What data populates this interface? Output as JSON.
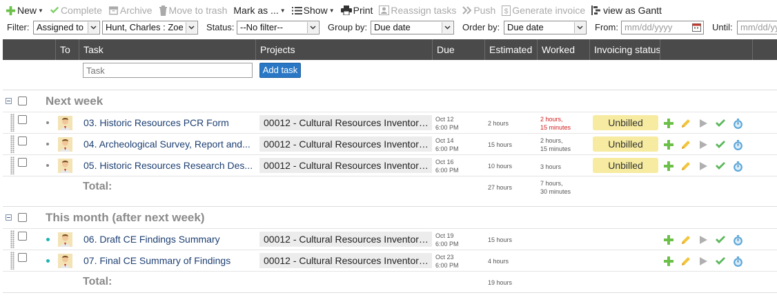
{
  "toolbar": {
    "new_label": "New",
    "complete_label": "Complete",
    "archive_label": "Archive",
    "trash_label": "Move to trash",
    "mark_label": "Mark as ...",
    "show_label": "Show",
    "print_label": "Print",
    "reassign_label": "Reassign tasks",
    "push_label": "Push",
    "invoice_label": "Generate invoice",
    "gantt_label": "view as Gantt"
  },
  "filters": {
    "filter_label": "Filter:",
    "filter_value": "Assigned to",
    "user_value": "Hunt, Charles : Zoe",
    "status_label": "Status:",
    "status_value": "--No filter--",
    "group_label": "Group by:",
    "group_value": "Due date",
    "order_label": "Order by:",
    "order_value": "Due date",
    "from_label": "From:",
    "from_placeholder": "mm/dd/yyyy",
    "until_label": "Until:",
    "until_placeholder": "mm/dd/yyyy"
  },
  "columns": {
    "to": "To",
    "task": "Task",
    "projects": "Projects",
    "due": "Due",
    "estimated": "Estimated",
    "worked": "Worked",
    "invoicing": "Invoicing status"
  },
  "add": {
    "task_placeholder": "Task",
    "button_label": "Add task"
  },
  "groups": [
    {
      "title": "Next week",
      "rows": [
        {
          "name": "03. Historic Resources PCR Form",
          "project": "00012 - Cultural Resources Inventory ...",
          "due_date": "Oct 12",
          "due_time": "6:00 PM",
          "estimated": "2 hours",
          "worked_1": "2 hours,",
          "worked_2": "15 minutes",
          "status": "Unbilled"
        },
        {
          "name": "04. Archeological Survey, Report and...",
          "project": "00012 - Cultural Resources Inventory ...",
          "due_date": "Oct 14",
          "due_time": "6:00 PM",
          "estimated": "15 hours",
          "worked_1": "2 hours,",
          "worked_2": "15 minutes",
          "status": "Unbilled"
        },
        {
          "name": "05. Historic Resources Research Des...",
          "project": "00012 - Cultural Resources Inventory ...",
          "due_date": "Oct 16",
          "due_time": "6:00 PM",
          "estimated": "10 hours",
          "worked_1": "3 hours",
          "worked_2": "",
          "status": "Unbilled"
        }
      ],
      "total_label": "Total:",
      "total_estimated": "27 hours",
      "total_worked_1": "7 hours,",
      "total_worked_2": "30 minutes"
    },
    {
      "title": "This month (after next week)",
      "rows": [
        {
          "name": "06. Draft CE Findings Summary",
          "project": "00012 - Cultural Resources Inventory ...",
          "due_date": "Oct 19",
          "due_time": "6:00 PM",
          "estimated": "15 hours"
        },
        {
          "name": "07. Final CE Summary of Findings",
          "project": "00012 - Cultural Resources Inventory ...",
          "due_date": "Oct 23",
          "due_time": "6:00 PM",
          "estimated": "4 hours"
        }
      ],
      "total_label": "Total:",
      "total_estimated": "19 hours"
    }
  ],
  "colors": {
    "header_bg": "#4a4a4a",
    "task_link": "#1d3f72",
    "unbilled_badge": "#f6eba0",
    "add_button": "#2a78c5",
    "over_budget": "#d01c1c"
  }
}
